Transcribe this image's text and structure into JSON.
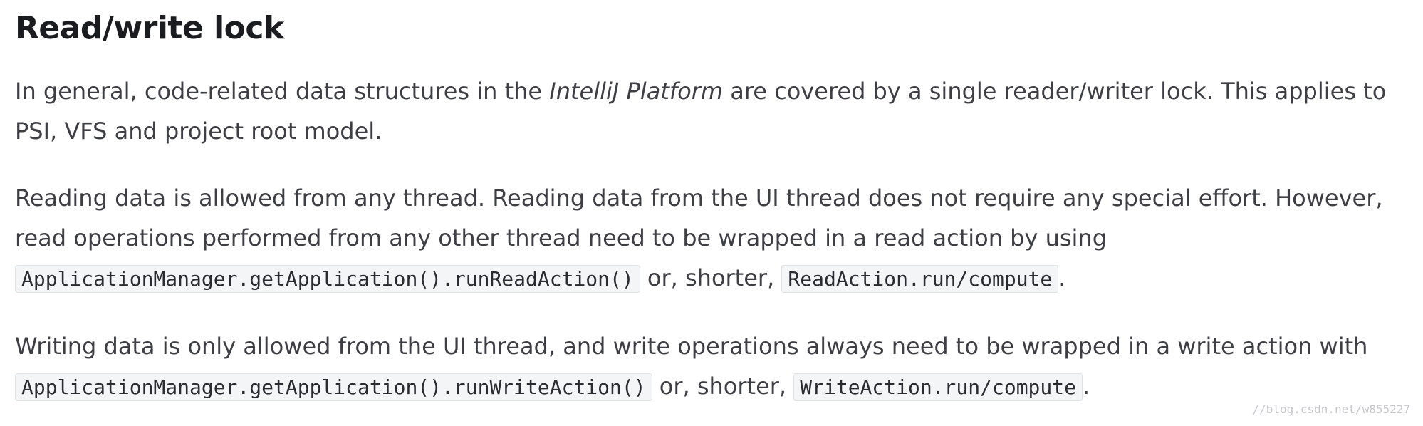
{
  "section": {
    "title": "Read/write lock"
  },
  "paragraphs": {
    "p1": {
      "before": "In general, code-related data structures in the ",
      "emphasis": "IntelliJ Platform",
      "after": " are covered by a single reader/writer lock. This applies to PSI, VFS and project root model."
    },
    "p2": {
      "before": "Reading data is allowed from any thread. Reading data from the UI thread does not require any special effort. However, read operations performed from any other thread need to be wrapped in a read action by using ",
      "code1": "ApplicationManager.getApplication().runReadAction()",
      "middle": " or, shorter, ",
      "code2": "ReadAction.run/compute",
      "after": "."
    },
    "p3": {
      "before": "Writing data is only allowed from the UI thread, and write operations always need to be wrapped in a write action with ",
      "code1": "ApplicationManager.getApplication().runWriteAction()",
      "middle": " or, shorter, ",
      "code2": "WriteAction.run/compute",
      "after": "."
    }
  },
  "watermark": "//blog.csdn.net/w855227"
}
